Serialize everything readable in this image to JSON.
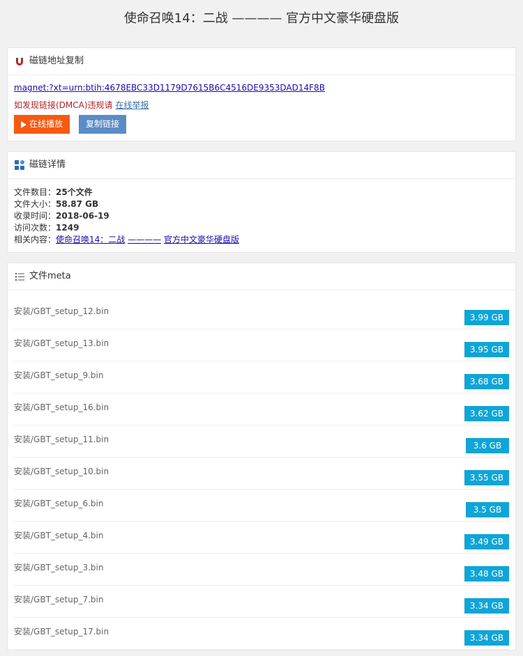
{
  "page": {
    "title": "使命召唤14：二战 ———— 官方中文豪华硬盘版"
  },
  "magnet_panel": {
    "heading": "磁链地址复制",
    "icon": "magnet-icon",
    "link": "magnet:?xt=urn:btih:4678EBC33D1179D7615B6C4516DE9353DAD14F8B",
    "dmca_text": "如发现链接(DMCA)违规请",
    "report_label": "在线举报",
    "play_label": "在线播放",
    "copy_label": "复制链接",
    "colors": {
      "play": "#f55a13",
      "copy": "#5b8cc5"
    }
  },
  "details_panel": {
    "heading": "磁链详情",
    "icon": "grid-icon",
    "rows": {
      "file_count": {
        "label": "文件数目：",
        "value": "25个文件"
      },
      "file_size": {
        "label": "文件大小：",
        "value": "58.87 GB"
      },
      "date": {
        "label": "收录时间：",
        "value": "2018-06-19"
      },
      "visits": {
        "label": "访问次数：",
        "value": "1249"
      },
      "related": {
        "label": "相关内容：",
        "link1": "使命召唤14：二战",
        "link2": "————",
        "link3": "官方中文豪华硬盘版"
      }
    }
  },
  "meta_panel": {
    "heading": "文件meta",
    "icon": "list-icon",
    "badge_color": "#0ea5d8",
    "files": [
      {
        "name": "安装/GBT_setup_12.bin",
        "size": "3.99 GB"
      },
      {
        "name": "安装/GBT_setup_13.bin",
        "size": "3.95 GB"
      },
      {
        "name": "安装/GBT_setup_9.bin",
        "size": "3.68 GB"
      },
      {
        "name": "安装/GBT_setup_16.bin",
        "size": "3.62 GB"
      },
      {
        "name": "安装/GBT_setup_11.bin",
        "size": "3.6 GB"
      },
      {
        "name": "安装/GBT_setup_10.bin",
        "size": "3.55 GB"
      },
      {
        "name": "安装/GBT_setup_6.bin",
        "size": "3.5 GB"
      },
      {
        "name": "安装/GBT_setup_4.bin",
        "size": "3.49 GB"
      },
      {
        "name": "安装/GBT_setup_3.bin",
        "size": "3.48 GB"
      },
      {
        "name": "安装/GBT_setup_7.bin",
        "size": "3.34 GB"
      },
      {
        "name": "安装/GBT_setup_17.bin",
        "size": "3.34 GB"
      }
    ]
  }
}
